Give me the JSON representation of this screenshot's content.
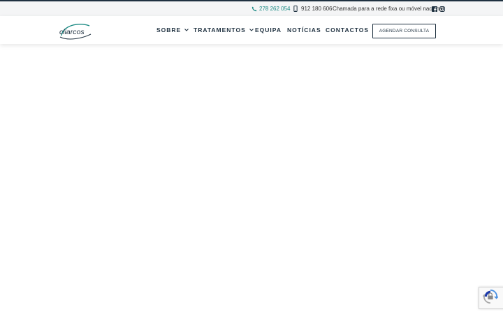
{
  "topbar": {
    "phone_landline": "278 262 054",
    "phone_mobile": "912 180 606",
    "call_note": "Chamada para a rede fixa ou móvel nacional.",
    "social": [
      "facebook-icon",
      "instagram-icon"
    ]
  },
  "header": {
    "logo_text": "cliarcos",
    "nav": [
      {
        "label": "SOBRE",
        "has_dropdown": true
      },
      {
        "label": "TRATAMENTOS",
        "has_dropdown": true
      },
      {
        "label": "EQUIPA",
        "has_dropdown": false
      },
      {
        "label": "NOTÍCIAS",
        "has_dropdown": false
      },
      {
        "label": "CONTACTOS",
        "has_dropdown": false
      }
    ],
    "cta_label": "AGENDAR CONSULTA"
  },
  "colors": {
    "accent": "#1a8a83",
    "navy": "#1f3140",
    "topbar_bg": "#f4f5f6"
  },
  "recaptcha": {
    "icon": "recaptcha-icon"
  }
}
